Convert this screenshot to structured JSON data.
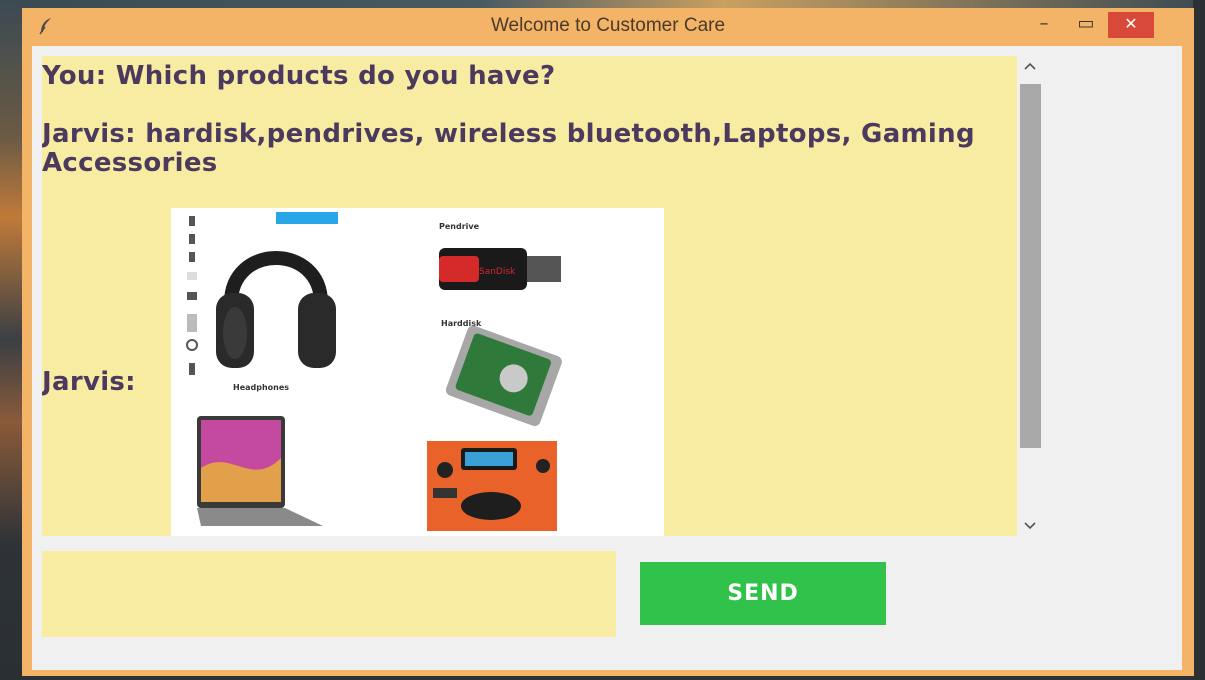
{
  "window": {
    "title": "Welcome to Customer Care",
    "controls": {
      "minimize": "–",
      "maximize": "▭",
      "close": "✕"
    }
  },
  "chat": {
    "messages": [
      {
        "text": "You: Which products do you have?"
      },
      {
        "text": "Jarvis: hardisk,pendrives, wireless bluetooth,Laptops, Gaming Accessories"
      },
      {
        "text": "Jarvis:"
      }
    ],
    "image": {
      "labels": {
        "pendrive": "Pendrive",
        "harddisk": "Harddisk",
        "headphones": "Headphones",
        "pendrive_brand": "SanDisk"
      }
    }
  },
  "input": {
    "value": "",
    "placeholder": ""
  },
  "send_button": {
    "label": "SEND"
  },
  "colors": {
    "frame": "#f4b468",
    "chat_bg": "#f8eba2",
    "text": "#4c3a5e",
    "send_bg": "#30c24a",
    "close_bg": "#d9493a"
  },
  "icons": {
    "app": "feather-icon",
    "minimize": "minimize-icon",
    "maximize": "maximize-icon",
    "close": "close-icon",
    "scroll_up": "chevron-up-icon",
    "scroll_down": "chevron-down-icon"
  }
}
